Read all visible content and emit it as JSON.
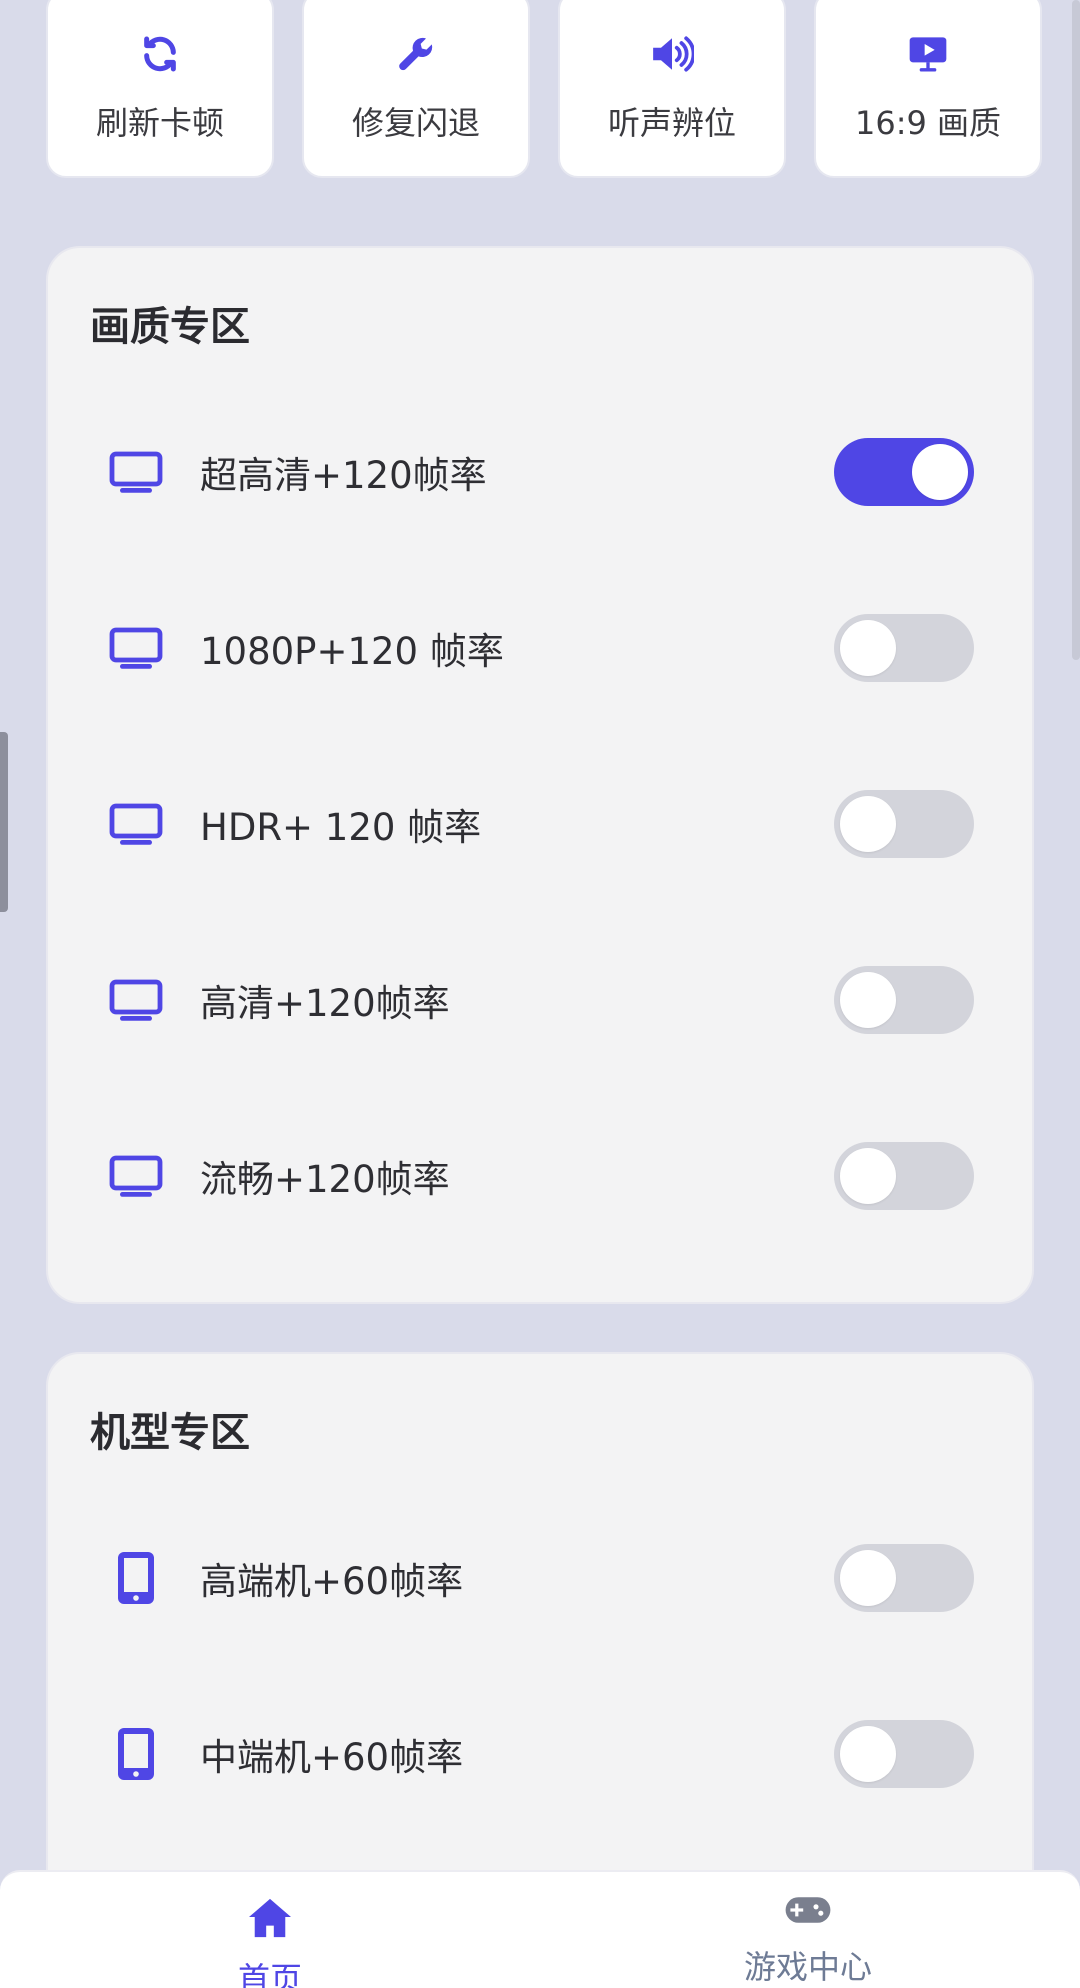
{
  "quick_actions": [
    {
      "label": "刷新卡顿",
      "icon": "refresh-icon"
    },
    {
      "label": "修复闪退",
      "icon": "wrench-icon"
    },
    {
      "label": "听声辨位",
      "icon": "speaker-icon"
    },
    {
      "label": "16:9 画质",
      "icon": "monitor-play-icon"
    }
  ],
  "quality_section": {
    "title": "画质专区",
    "items": [
      {
        "label": "超高清+120帧率",
        "icon": "monitor-icon",
        "enabled": true
      },
      {
        "label": "1080P+120 帧率",
        "icon": "monitor-icon",
        "enabled": false
      },
      {
        "label": "HDR+ 120 帧率",
        "icon": "monitor-icon",
        "enabled": false
      },
      {
        "label": "高清+120帧率",
        "icon": "monitor-icon",
        "enabled": false
      },
      {
        "label": "流畅+120帧率",
        "icon": "monitor-icon",
        "enabled": false
      }
    ]
  },
  "device_section": {
    "title": "机型专区",
    "items": [
      {
        "label": "高端机+60帧率",
        "icon": "phone-icon",
        "enabled": false
      },
      {
        "label": "中端机+60帧率",
        "icon": "phone-icon",
        "enabled": false
      }
    ]
  },
  "bottom_nav": {
    "home": {
      "label": "首页",
      "icon": "home-icon",
      "active": true
    },
    "game": {
      "label": "游戏中心",
      "icon": "gamepad-icon",
      "active": false
    }
  },
  "colors": {
    "accent": "#4f46e5",
    "background": "#d9dbea",
    "panel": "#f3f3f4",
    "toggle_off": "#d3d4db"
  }
}
